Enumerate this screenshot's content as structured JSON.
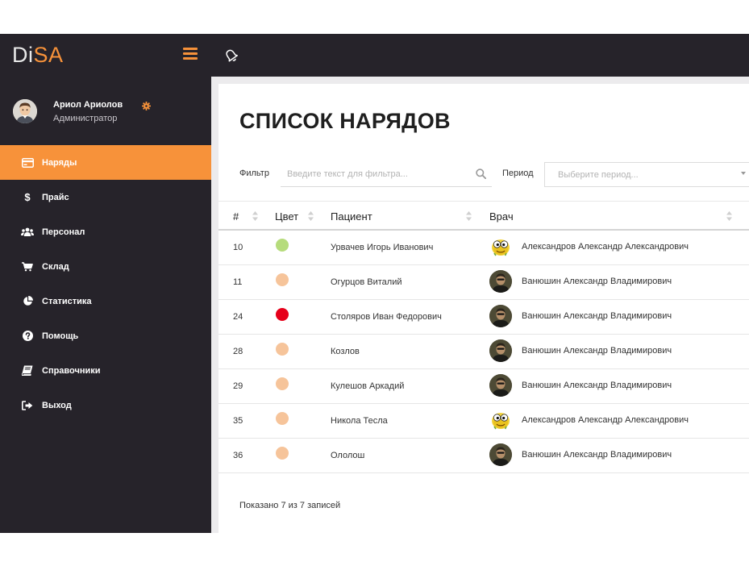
{
  "brand": {
    "logo_prefix": "Di",
    "logo_highlight": "SA"
  },
  "user": {
    "name": "Ариол Ариолов",
    "role": "Администратор"
  },
  "sidebar": {
    "items": [
      {
        "label": "Наряды",
        "icon": "card-icon",
        "active": true
      },
      {
        "label": "Прайс",
        "icon": "dollar-icon",
        "active": false
      },
      {
        "label": "Персонал",
        "icon": "users-icon",
        "active": false
      },
      {
        "label": "Склад",
        "icon": "cart-icon",
        "active": false
      },
      {
        "label": "Статистика",
        "icon": "pie-chart-icon",
        "active": false
      },
      {
        "label": "Помощь",
        "icon": "question-icon",
        "active": false
      },
      {
        "label": "Справочники",
        "icon": "book-icon",
        "active": false
      },
      {
        "label": "Выход",
        "icon": "sign-out-icon",
        "active": false
      }
    ]
  },
  "main": {
    "title": "СПИСОК НАРЯДОВ",
    "filter": {
      "label": "Фильтр",
      "placeholder": "Введите текст для фильтра...",
      "value": ""
    },
    "period": {
      "label": "Период",
      "placeholder": "Выберите период..."
    },
    "table": {
      "columns": [
        "#",
        "Цвет",
        "Пациент",
        "Врач"
      ],
      "rows": [
        {
          "id": "10",
          "color": "#b6dc7c",
          "patient": "Урвачев Игорь Иванович",
          "doctor": "Александров Александр Александрович",
          "avatar": "smiley"
        },
        {
          "id": "11",
          "color": "#f6c49a",
          "patient": "Огурцов Виталий",
          "doctor": "Ванюшин Александр Владимирович",
          "avatar": "photo"
        },
        {
          "id": "24",
          "color": "#e6001a",
          "patient": "Столяров Иван Федорович",
          "doctor": "Ванюшин Александр Владимирович",
          "avatar": "photo"
        },
        {
          "id": "28",
          "color": "#f6c49a",
          "patient": "Козлов",
          "doctor": "Ванюшин Александр Владимирович",
          "avatar": "photo"
        },
        {
          "id": "29",
          "color": "#f6c49a",
          "patient": "Кулешов Аркадий",
          "doctor": "Ванюшин Александр Владимирович",
          "avatar": "photo"
        },
        {
          "id": "35",
          "color": "#f6c49a",
          "patient": "Никола Тесла",
          "doctor": "Александров Александр Александрович",
          "avatar": "smiley"
        },
        {
          "id": "36",
          "color": "#f6c49a",
          "patient": "Ололош",
          "doctor": "Ванюшин Александр Владимирович",
          "avatar": "photo"
        }
      ]
    },
    "footer": "Показано 7 из 7 записей"
  },
  "colors": {
    "accent": "#f7923a",
    "dark": "#26232a"
  }
}
